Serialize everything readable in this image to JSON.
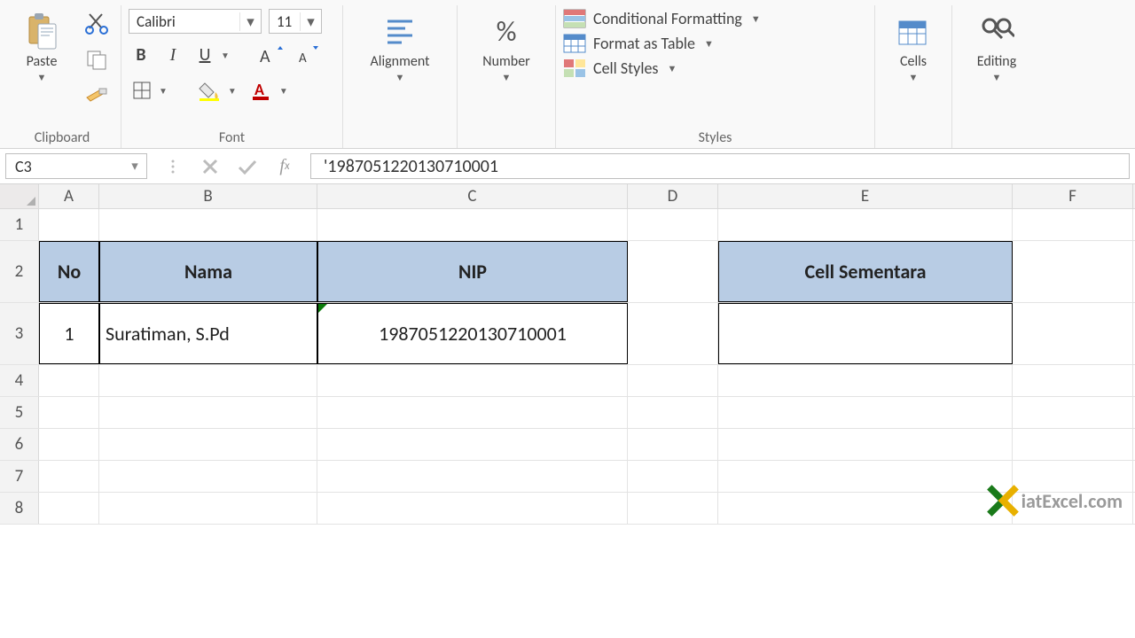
{
  "ribbon": {
    "clipboard": {
      "label": "Clipboard",
      "paste": "Paste"
    },
    "font": {
      "label": "Font",
      "name": "Calibri",
      "size": "11",
      "bold": "B",
      "italic": "I",
      "underline": "U"
    },
    "alignment": {
      "label": "Alignment"
    },
    "number": {
      "label": "Number"
    },
    "styles": {
      "label": "Styles",
      "cond": "Conditional Formatting",
      "table": "Format as Table",
      "cell": "Cell Styles"
    },
    "cells": {
      "label": "Cells"
    },
    "editing": {
      "label": "Editing"
    }
  },
  "formula_bar": {
    "namebox": "C3",
    "formula": "'198705122013071­0001"
  },
  "columns": [
    "A",
    "B",
    "C",
    "D",
    "E",
    "F"
  ],
  "rows": [
    "1",
    "2",
    "3",
    "4",
    "5",
    "6",
    "7",
    "8"
  ],
  "sheet": {
    "headers": {
      "no": "No",
      "nama": "Nama",
      "nip": "NIP",
      "sementara": "Cell Sementara"
    },
    "row3": {
      "no": "1",
      "nama": "Suratiman, S.Pd",
      "nip": "198705122013071­0001"
    }
  },
  "watermark": "iatExcel.com"
}
